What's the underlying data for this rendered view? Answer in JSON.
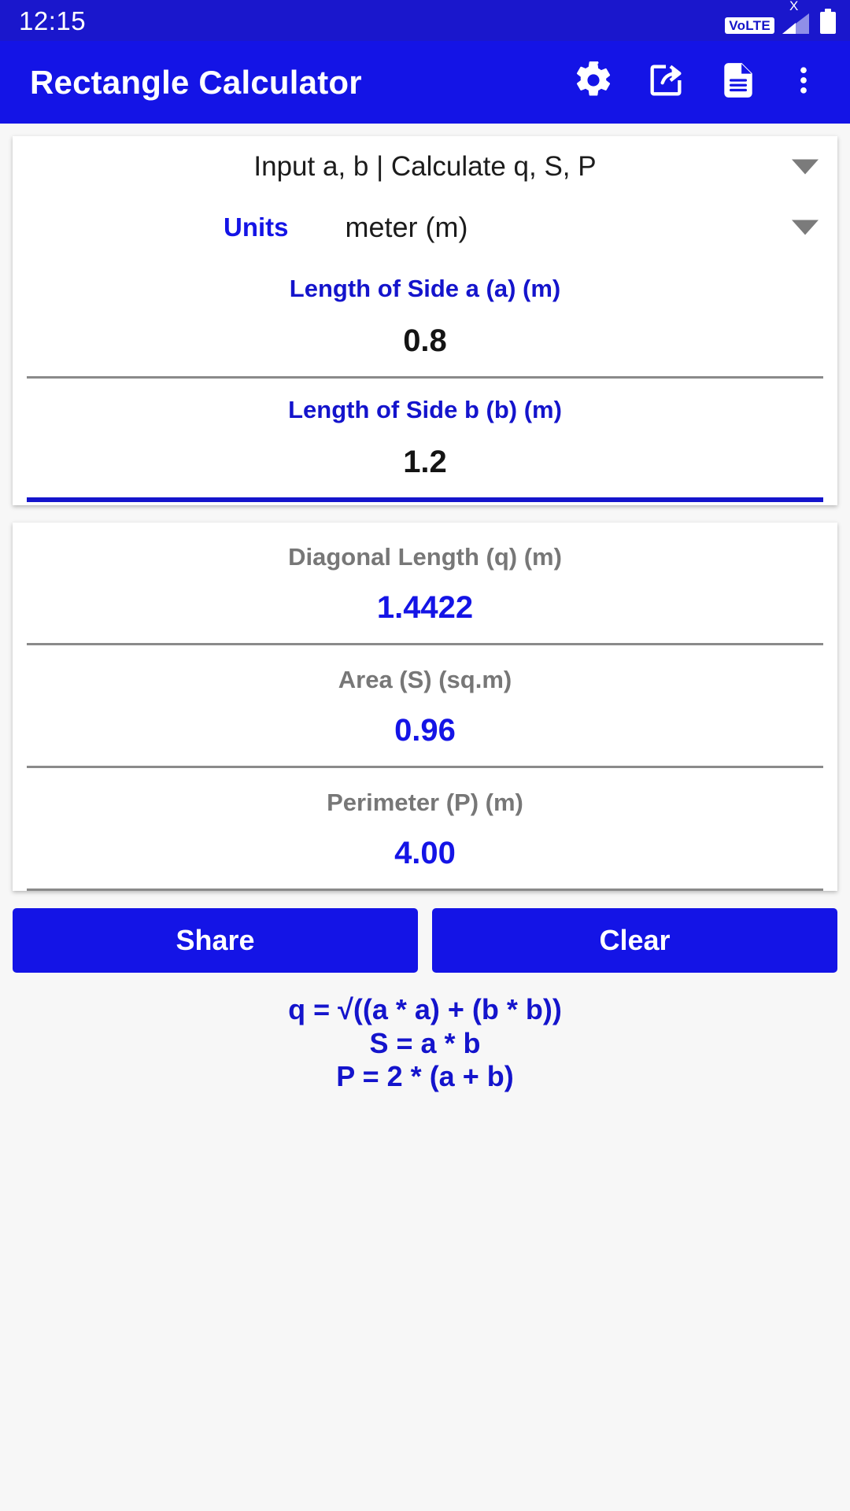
{
  "status_bar": {
    "time": "12:15",
    "volte_label": "VoLTE",
    "signal_badge": "X",
    "icons": [
      "volte-icon",
      "signal-icon",
      "battery-icon"
    ]
  },
  "app_bar": {
    "title": "Rectangle Calculator",
    "actions": [
      {
        "name": "settings-icon",
        "label": "Settings"
      },
      {
        "name": "share-export-icon",
        "label": "Export"
      },
      {
        "name": "document-icon",
        "label": "Notes"
      },
      {
        "name": "overflow-menu-icon",
        "label": "More options"
      }
    ]
  },
  "input_card": {
    "mode": "Input a, b | Calculate q, S, P",
    "units_label": "Units",
    "units_value": "meter (m)",
    "fields": [
      {
        "label": "Length of Side a (a) (m)",
        "value": "0.8",
        "focused": false
      },
      {
        "label": "Length of Side b (b) (m)",
        "value": "1.2",
        "focused": true
      }
    ]
  },
  "results_card": {
    "rows": [
      {
        "label": "Diagonal Length (q) (m)",
        "value": "1.4422"
      },
      {
        "label": "Area (S) (sq.m)",
        "value": "0.96"
      },
      {
        "label": "Perimeter (P) (m)",
        "value": "4.00"
      }
    ]
  },
  "buttons": {
    "share": "Share",
    "clear": "Clear"
  },
  "formulas": [
    "q = √((a * a) + (b * b))",
    "S = a * b",
    "P = 2 * (a + b)"
  ],
  "colors": {
    "primary": "#1414e6",
    "status_bar": "#1a17cc",
    "accent_text": "#1414cc",
    "result_value": "#1414e6",
    "result_label": "#777777",
    "page_bg": "#f7f7f7"
  }
}
